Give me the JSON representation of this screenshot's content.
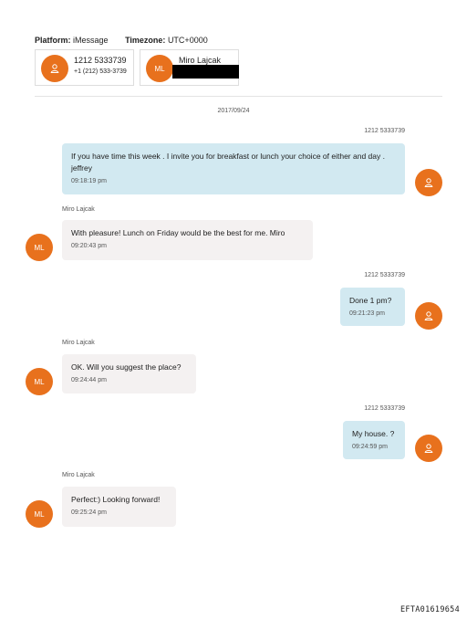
{
  "header": {
    "platform_label": "Platform:",
    "platform_value": "iMessage",
    "timezone_label": "Timezone:",
    "timezone_value": "UTC+0000"
  },
  "participants": [
    {
      "name": "1212 5333739",
      "number": "+1 (212) 533-3739",
      "avatar": "user-icon"
    },
    {
      "name": "Miro Lajcak",
      "initials": "ML",
      "redacted": true
    }
  ],
  "date": "2017/09/24",
  "messages": [
    {
      "sender": "1212 5333739",
      "direction": "out",
      "text": "If you have time this week . I invite you for breakfast or lunch your choice of either and day .   jeffrey",
      "time": "09:18:19 pm"
    },
    {
      "sender": "Miro Lajcak",
      "direction": "in",
      "text": "With pleasure! Lunch on Friday would be the best for me. Miro",
      "time": "09:20:43 pm",
      "initials": "ML"
    },
    {
      "sender": "1212 5333739",
      "direction": "out",
      "text": "Done  1 pm?",
      "time": "09:21:23 pm"
    },
    {
      "sender": "Miro Lajcak",
      "direction": "in",
      "text": "OK. Will you suggest the place?",
      "time": "09:24:44 pm",
      "initials": "ML"
    },
    {
      "sender": "1212 5333739",
      "direction": "out",
      "text": "My house. ?",
      "time": "09:24:59 pm"
    },
    {
      "sender": "Miro Lajcak",
      "direction": "in",
      "text": "Perfect:) Looking forward!",
      "time": "09:25:24 pm",
      "initials": "ML"
    }
  ],
  "footer": "EFTA01619654",
  "colors": {
    "avatar": "#e8711d",
    "outgoing_bubble": "#d2e9f1",
    "incoming_bubble": "#f4f1f1"
  }
}
